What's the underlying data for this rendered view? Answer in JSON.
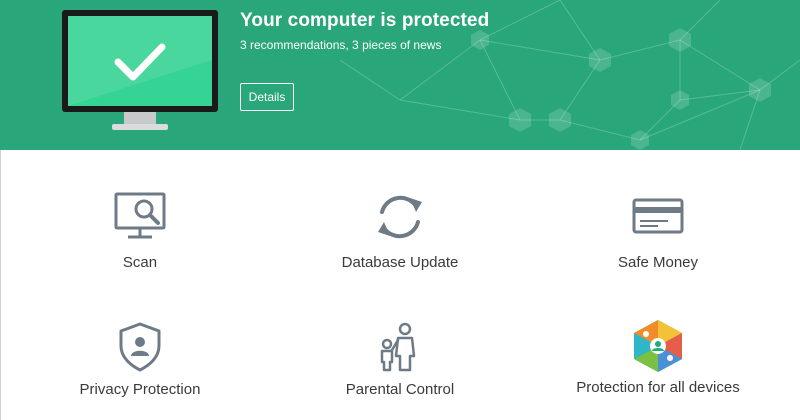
{
  "status": {
    "title": "Your computer is protected",
    "subtitle": "3 recommendations, 3 pieces of news",
    "details_label": "Details"
  },
  "tiles": [
    {
      "label": "Scan",
      "icon": "monitor-magnifier-icon"
    },
    {
      "label": "Database Update",
      "icon": "refresh-arrows-icon"
    },
    {
      "label": "Safe Money",
      "icon": "credit-card-icon"
    },
    {
      "label": "Privacy Protection",
      "icon": "shield-user-icon"
    },
    {
      "label": "Parental Control",
      "icon": "parent-child-icon"
    },
    {
      "label": "Protection for all devices",
      "icon": "devices-map-icon"
    }
  ],
  "colors": {
    "header_green": "#29a77b",
    "screen_green": "#2fcf8f",
    "icon_gray": "#6e7b87",
    "text": "#3a3a3a"
  }
}
